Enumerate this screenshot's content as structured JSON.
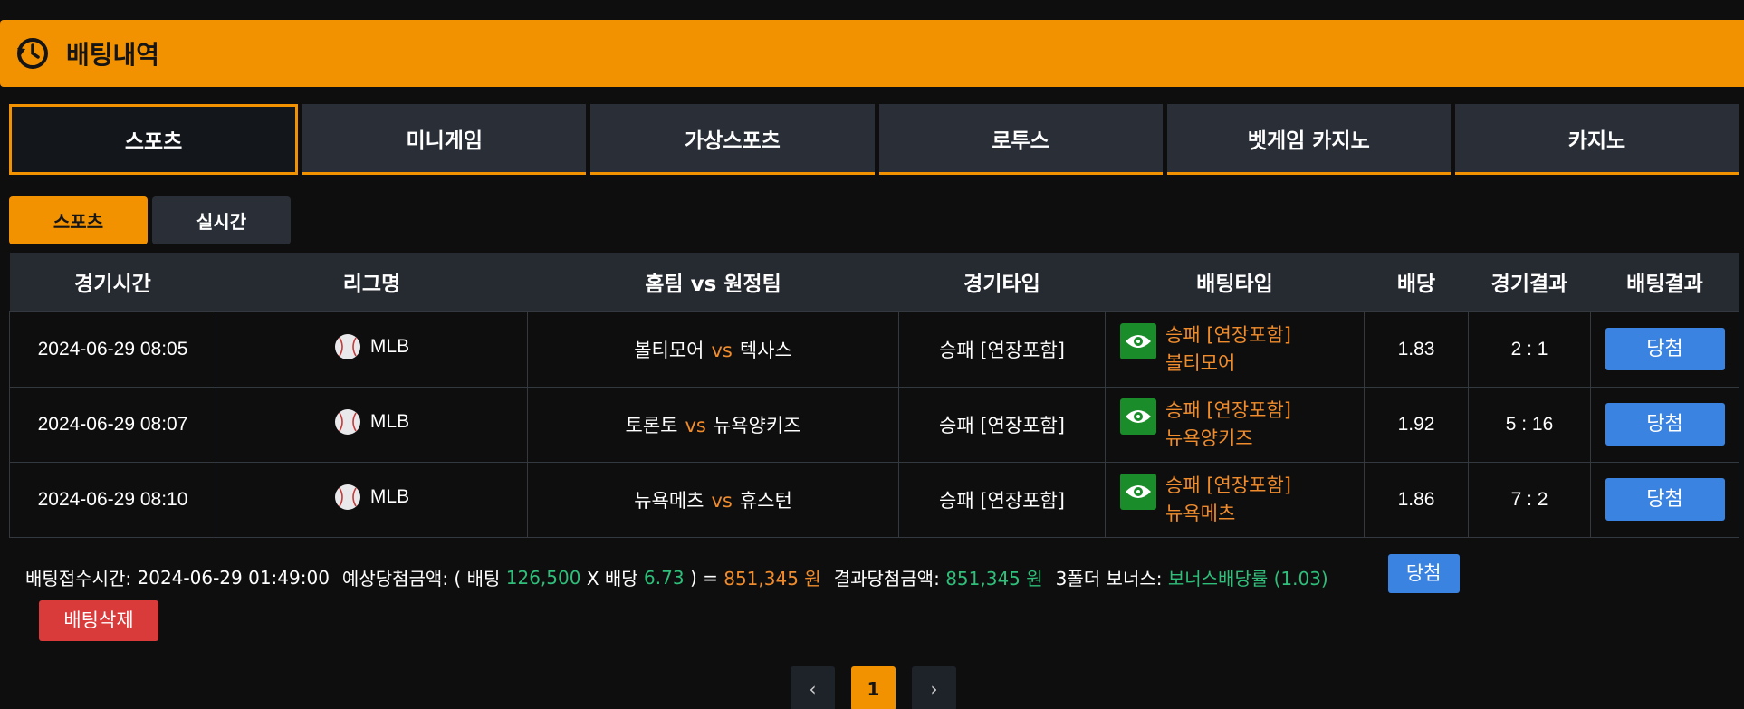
{
  "header": {
    "title": "배팅내역",
    "icon": "clock-history-icon"
  },
  "tabs": [
    {
      "label": "스포츠",
      "active": true
    },
    {
      "label": "미니게임"
    },
    {
      "label": "가상스포츠"
    },
    {
      "label": "로투스"
    },
    {
      "label": "벳게임 카지노"
    },
    {
      "label": "카지노"
    }
  ],
  "subtabs": [
    {
      "label": "스포츠",
      "active": true
    },
    {
      "label": "실시간"
    }
  ],
  "table": {
    "headers": [
      "경기시간",
      "리그명",
      "홈팀 vs 원정팀",
      "경기타입",
      "배팅타입",
      "배당",
      "경기결과",
      "배팅결과"
    ],
    "rows": [
      {
        "time": "2024-06-29 08:05",
        "league": "MLB",
        "home": "볼티모어",
        "vs": "vs",
        "away": "텍사스",
        "game_type": "승패 [연장포함]",
        "bet_type": "승패 [연장포함]",
        "bet_pick": "볼티모어",
        "odds": "1.83",
        "score": "2 : 1",
        "result": "당첨"
      },
      {
        "time": "2024-06-29 08:07",
        "league": "MLB",
        "home": "토론토",
        "vs": "vs",
        "away": "뉴욕양키즈",
        "game_type": "승패 [연장포함]",
        "bet_type": "승패 [연장포함]",
        "bet_pick": "뉴욕양키즈",
        "odds": "1.92",
        "score": "5 : 16",
        "result": "당첨"
      },
      {
        "time": "2024-06-29 08:10",
        "league": "MLB",
        "home": "뉴욕메츠",
        "vs": "vs",
        "away": "휴스턴",
        "game_type": "승패 [연장포함]",
        "bet_type": "승패 [연장포함]",
        "bet_pick": "뉴욕메츠",
        "odds": "1.86",
        "score": "7 : 2",
        "result": "당첨"
      }
    ]
  },
  "summary": {
    "received_label": "배팅접수시간:",
    "received_value": "2024-06-29 01:49:00",
    "expected_label": "예상당첨금액: ( 배팅",
    "bet_amount": "126,500",
    "times_label": "X 배당",
    "total_odds": "6.73",
    "equals": ") =",
    "expected_amount": "851,345 원",
    "result_label": "결과당첨금액:",
    "result_amount": "851,345 원",
    "bonus_label": "3폴더 보너스:",
    "bonus_value": "보너스배당률 (1.03)",
    "status_button": "당첨",
    "delete_button": "배팅삭제"
  },
  "pagination": {
    "prev": "‹",
    "current": "1",
    "next": "›"
  },
  "colors": {
    "accent": "#f39200",
    "win": "#3b83e0",
    "delete": "#d93a3a",
    "green": "#2fbf7a",
    "orange": "#f08c2c"
  }
}
